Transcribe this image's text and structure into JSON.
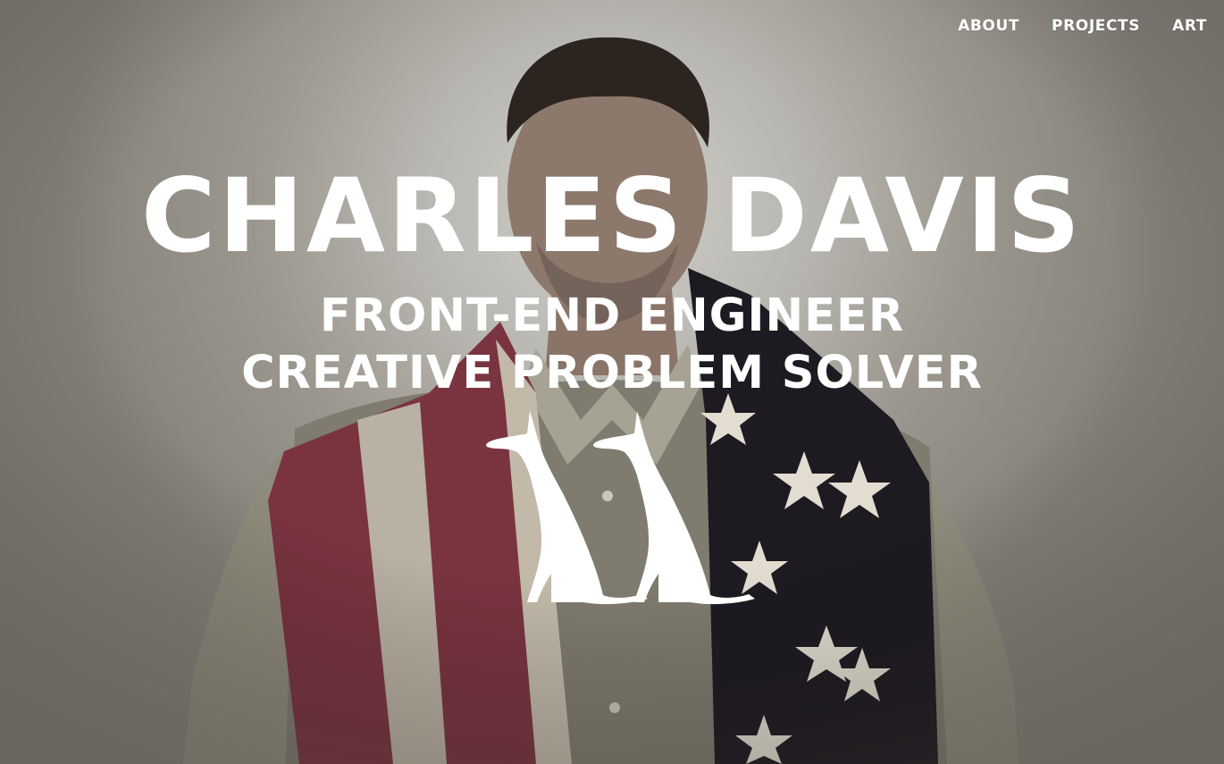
{
  "nav": {
    "items": [
      {
        "label": "ABOUT"
      },
      {
        "label": "PROJECTS"
      },
      {
        "label": "ART"
      }
    ]
  },
  "hero": {
    "name": "CHARLES DAVIS",
    "subtitle_line1": "FRONT-END ENGINEER",
    "subtitle_line2": "CREATIVE PROBLEM SOLVER"
  },
  "logo": {
    "icon": "two-dogs-logo-icon"
  },
  "colors": {
    "text": "#ffffff",
    "background": "#9b978e",
    "flag_red": "#7a3440",
    "flag_navy": "#1e1a22"
  }
}
